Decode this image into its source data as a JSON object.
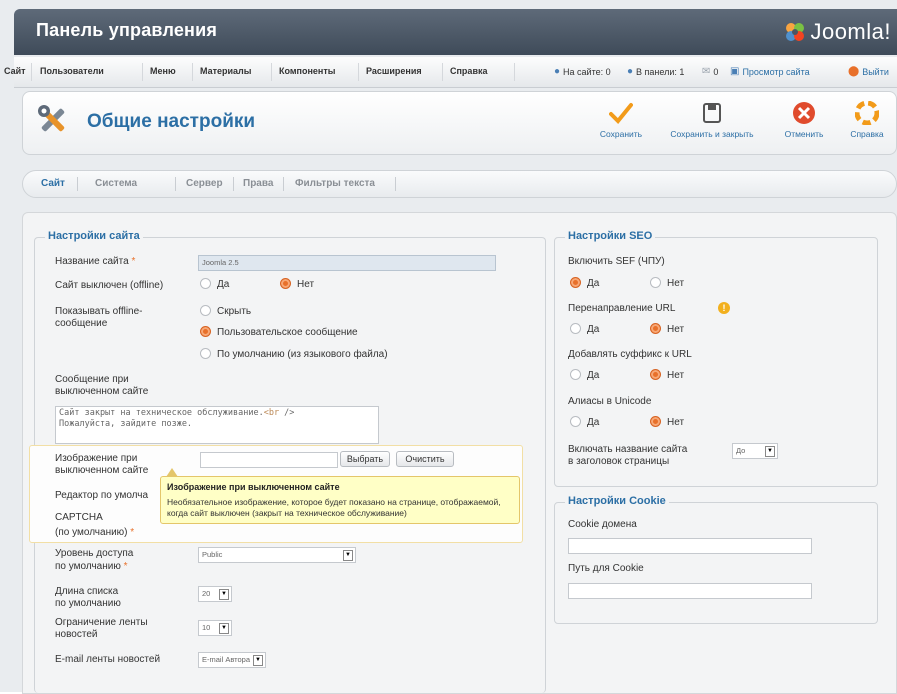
{
  "header": {
    "title": "Панель управления",
    "logo": "Joomla!"
  },
  "menu": {
    "items": [
      "Сайт",
      "Пользователи",
      "Меню",
      "Материалы",
      "Компоненты",
      "Расширения",
      "Справка"
    ],
    "status": {
      "on_site": "На сайте: 0",
      "in_panel": "В панели: 1",
      "messages": "0",
      "view_site": "Просмотр сайта",
      "logout": "Выйти"
    }
  },
  "toolbar": {
    "title": "Общие настройки",
    "save": "Сохранить",
    "save_close": "Сохранить и закрыть",
    "cancel": "Отменить",
    "help": "Справка"
  },
  "tabs": [
    "Сайт",
    "Система",
    "Сервер",
    "Права",
    "Фильтры текста"
  ],
  "site_settings": {
    "legend": "Настройки сайта",
    "site_name_label": "Название сайта",
    "site_name_value": "Joomla 2.5",
    "offline_label": "Сайт выключен (offline)",
    "offline_yes": "Да",
    "offline_no": "Нет",
    "show_offline_label_1": "Показывать offline-",
    "show_offline_label_2": "сообщение",
    "show_hide": "Скрыть",
    "show_custom": "Пользовательское сообщение",
    "show_default": "По умолчанию (из языкового файла)",
    "offline_msg_label_1": "Сообщение при",
    "offline_msg_label_2": "выключенном сайте",
    "offline_msg_line_1_a": "Сайт закрыт на техническое обслуживание.",
    "offline_msg_tag": "<br",
    "offline_msg_line_1_b": " />",
    "offline_msg_line_2": "Пожалуйста, зайдите позже.",
    "offline_image_label_1": "Изображение при",
    "offline_image_label_2": "выключенном сайте",
    "select_btn": "Выбрать",
    "clear_btn": "Очистить",
    "editor_label": "Редактор по умолча",
    "captcha_label_1": "CAPTCHA",
    "captcha_label_2": "(по умолчанию)",
    "access_label_1": "Уровень доступа",
    "access_label_2": "по умолчанию",
    "access_value": "Public",
    "list_label_1": "Длина списка",
    "list_label_2": "по умолчанию",
    "list_value": "20",
    "feed_limit_label_1": "Ограничение ленты",
    "feed_limit_label_2": "новостей",
    "feed_limit_value": "10",
    "feed_email_label": "E-mail ленты новостей",
    "feed_email_value": "E-mail Автора"
  },
  "tooltip": {
    "title": "Изображение при выключенном сайте",
    "text": "Необязательное изображение, которое будет показано на странице, отображаемой, когда сайт выключен (закрыт на техническое обслуживание)"
  },
  "seo": {
    "legend": "Настройки SEO",
    "sef_label": "Включить SEF (ЧПУ)",
    "rewrite_label": "Перенаправление URL",
    "suffix_label": "Добавлять суффикс к URL",
    "unicode_label": "Алиасы в Unicode",
    "sitename_label_1": "Включать название сайта",
    "sitename_label_2": "в заголовок страницы",
    "sitename_value": "До",
    "yes": "Да",
    "no": "Нет"
  },
  "cookie": {
    "legend": "Настройки Cookie",
    "domain_label": "Cookie домена",
    "path_label": "Путь для Cookie"
  },
  "colors": {
    "accent": "#2c6fa5",
    "radio_on": "#e8702a",
    "header": "#4a5563"
  }
}
